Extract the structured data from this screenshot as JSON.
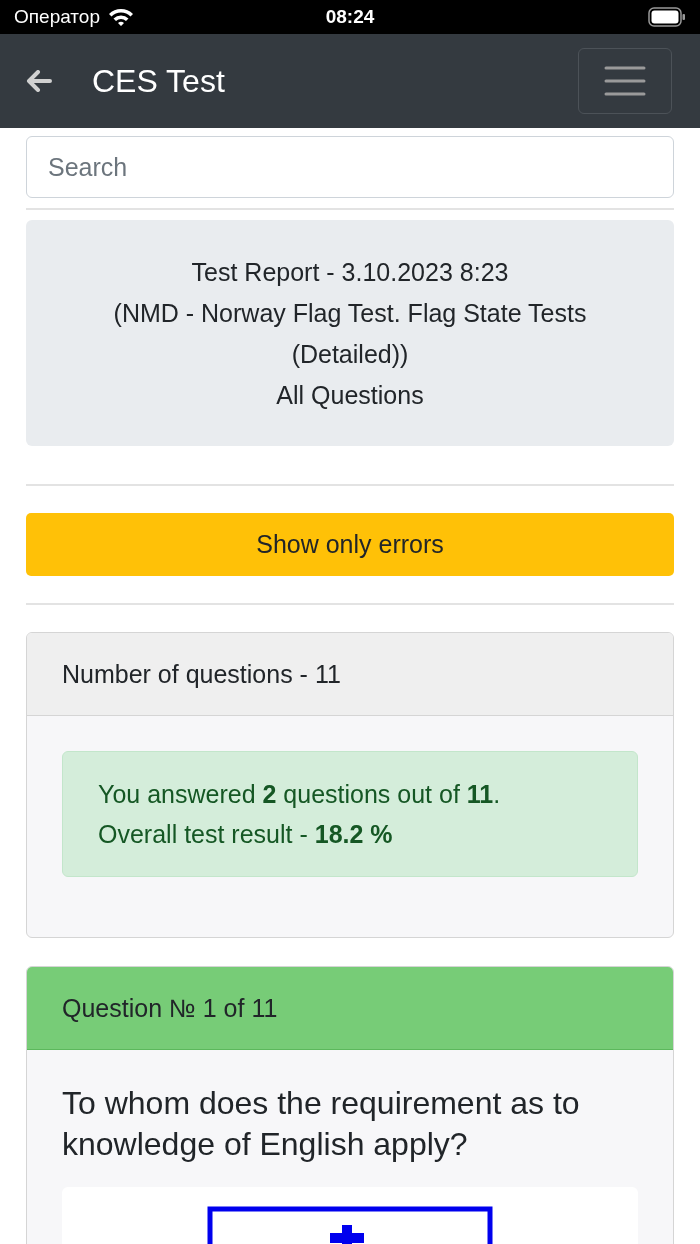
{
  "status_bar": {
    "carrier": "Оператор",
    "time": "08:24"
  },
  "navbar": {
    "title": "CES Test"
  },
  "search": {
    "placeholder": "Search"
  },
  "report": {
    "lines": [
      "Test Report - 3.10.2023 8:23",
      "(NMD - Norway Flag Test. Flag State Tests (Detailed))",
      "All Questions"
    ]
  },
  "filter_button": {
    "label": "Show only errors"
  },
  "summary": {
    "header": "Number of questions - 11",
    "result_lines": [
      "You answered **2** questions out of **11**.",
      "Overall test result - **18.2 %**"
    ]
  },
  "question": {
    "header": "Question № 1 of 11",
    "text": "To whom does the requirement as to knowledge of English apply?"
  }
}
